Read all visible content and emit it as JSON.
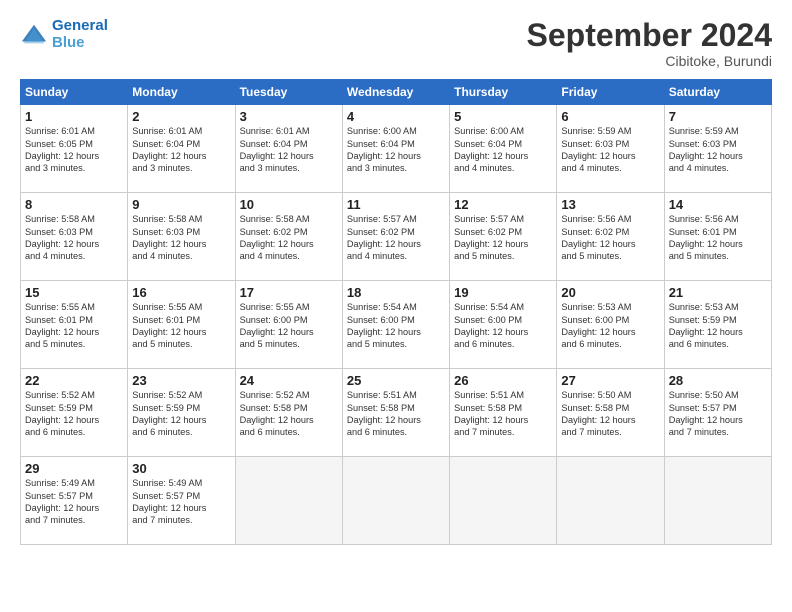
{
  "header": {
    "logo_line1": "General",
    "logo_line2": "Blue",
    "month": "September 2024",
    "location": "Cibitoke, Burundi"
  },
  "weekdays": [
    "Sunday",
    "Monday",
    "Tuesday",
    "Wednesday",
    "Thursday",
    "Friday",
    "Saturday"
  ],
  "weeks": [
    [
      {
        "day": "1",
        "lines": [
          "Sunrise: 6:01 AM",
          "Sunset: 6:05 PM",
          "Daylight: 12 hours",
          "and 3 minutes."
        ]
      },
      {
        "day": "2",
        "lines": [
          "Sunrise: 6:01 AM",
          "Sunset: 6:04 PM",
          "Daylight: 12 hours",
          "and 3 minutes."
        ]
      },
      {
        "day": "3",
        "lines": [
          "Sunrise: 6:01 AM",
          "Sunset: 6:04 PM",
          "Daylight: 12 hours",
          "and 3 minutes."
        ]
      },
      {
        "day": "4",
        "lines": [
          "Sunrise: 6:00 AM",
          "Sunset: 6:04 PM",
          "Daylight: 12 hours",
          "and 3 minutes."
        ]
      },
      {
        "day": "5",
        "lines": [
          "Sunrise: 6:00 AM",
          "Sunset: 6:04 PM",
          "Daylight: 12 hours",
          "and 4 minutes."
        ]
      },
      {
        "day": "6",
        "lines": [
          "Sunrise: 5:59 AM",
          "Sunset: 6:03 PM",
          "Daylight: 12 hours",
          "and 4 minutes."
        ]
      },
      {
        "day": "7",
        "lines": [
          "Sunrise: 5:59 AM",
          "Sunset: 6:03 PM",
          "Daylight: 12 hours",
          "and 4 minutes."
        ]
      }
    ],
    [
      {
        "day": "8",
        "lines": [
          "Sunrise: 5:58 AM",
          "Sunset: 6:03 PM",
          "Daylight: 12 hours",
          "and 4 minutes."
        ]
      },
      {
        "day": "9",
        "lines": [
          "Sunrise: 5:58 AM",
          "Sunset: 6:03 PM",
          "Daylight: 12 hours",
          "and 4 minutes."
        ]
      },
      {
        "day": "10",
        "lines": [
          "Sunrise: 5:58 AM",
          "Sunset: 6:02 PM",
          "Daylight: 12 hours",
          "and 4 minutes."
        ]
      },
      {
        "day": "11",
        "lines": [
          "Sunrise: 5:57 AM",
          "Sunset: 6:02 PM",
          "Daylight: 12 hours",
          "and 4 minutes."
        ]
      },
      {
        "day": "12",
        "lines": [
          "Sunrise: 5:57 AM",
          "Sunset: 6:02 PM",
          "Daylight: 12 hours",
          "and 5 minutes."
        ]
      },
      {
        "day": "13",
        "lines": [
          "Sunrise: 5:56 AM",
          "Sunset: 6:02 PM",
          "Daylight: 12 hours",
          "and 5 minutes."
        ]
      },
      {
        "day": "14",
        "lines": [
          "Sunrise: 5:56 AM",
          "Sunset: 6:01 PM",
          "Daylight: 12 hours",
          "and 5 minutes."
        ]
      }
    ],
    [
      {
        "day": "15",
        "lines": [
          "Sunrise: 5:55 AM",
          "Sunset: 6:01 PM",
          "Daylight: 12 hours",
          "and 5 minutes."
        ]
      },
      {
        "day": "16",
        "lines": [
          "Sunrise: 5:55 AM",
          "Sunset: 6:01 PM",
          "Daylight: 12 hours",
          "and 5 minutes."
        ]
      },
      {
        "day": "17",
        "lines": [
          "Sunrise: 5:55 AM",
          "Sunset: 6:00 PM",
          "Daylight: 12 hours",
          "and 5 minutes."
        ]
      },
      {
        "day": "18",
        "lines": [
          "Sunrise: 5:54 AM",
          "Sunset: 6:00 PM",
          "Daylight: 12 hours",
          "and 5 minutes."
        ]
      },
      {
        "day": "19",
        "lines": [
          "Sunrise: 5:54 AM",
          "Sunset: 6:00 PM",
          "Daylight: 12 hours",
          "and 6 minutes."
        ]
      },
      {
        "day": "20",
        "lines": [
          "Sunrise: 5:53 AM",
          "Sunset: 6:00 PM",
          "Daylight: 12 hours",
          "and 6 minutes."
        ]
      },
      {
        "day": "21",
        "lines": [
          "Sunrise: 5:53 AM",
          "Sunset: 5:59 PM",
          "Daylight: 12 hours",
          "and 6 minutes."
        ]
      }
    ],
    [
      {
        "day": "22",
        "lines": [
          "Sunrise: 5:52 AM",
          "Sunset: 5:59 PM",
          "Daylight: 12 hours",
          "and 6 minutes."
        ]
      },
      {
        "day": "23",
        "lines": [
          "Sunrise: 5:52 AM",
          "Sunset: 5:59 PM",
          "Daylight: 12 hours",
          "and 6 minutes."
        ]
      },
      {
        "day": "24",
        "lines": [
          "Sunrise: 5:52 AM",
          "Sunset: 5:58 PM",
          "Daylight: 12 hours",
          "and 6 minutes."
        ]
      },
      {
        "day": "25",
        "lines": [
          "Sunrise: 5:51 AM",
          "Sunset: 5:58 PM",
          "Daylight: 12 hours",
          "and 6 minutes."
        ]
      },
      {
        "day": "26",
        "lines": [
          "Sunrise: 5:51 AM",
          "Sunset: 5:58 PM",
          "Daylight: 12 hours",
          "and 7 minutes."
        ]
      },
      {
        "day": "27",
        "lines": [
          "Sunrise: 5:50 AM",
          "Sunset: 5:58 PM",
          "Daylight: 12 hours",
          "and 7 minutes."
        ]
      },
      {
        "day": "28",
        "lines": [
          "Sunrise: 5:50 AM",
          "Sunset: 5:57 PM",
          "Daylight: 12 hours",
          "and 7 minutes."
        ]
      }
    ],
    [
      {
        "day": "29",
        "lines": [
          "Sunrise: 5:49 AM",
          "Sunset: 5:57 PM",
          "Daylight: 12 hours",
          "and 7 minutes."
        ]
      },
      {
        "day": "30",
        "lines": [
          "Sunrise: 5:49 AM",
          "Sunset: 5:57 PM",
          "Daylight: 12 hours",
          "and 7 minutes."
        ]
      },
      {
        "day": "",
        "lines": []
      },
      {
        "day": "",
        "lines": []
      },
      {
        "day": "",
        "lines": []
      },
      {
        "day": "",
        "lines": []
      },
      {
        "day": "",
        "lines": []
      }
    ]
  ]
}
